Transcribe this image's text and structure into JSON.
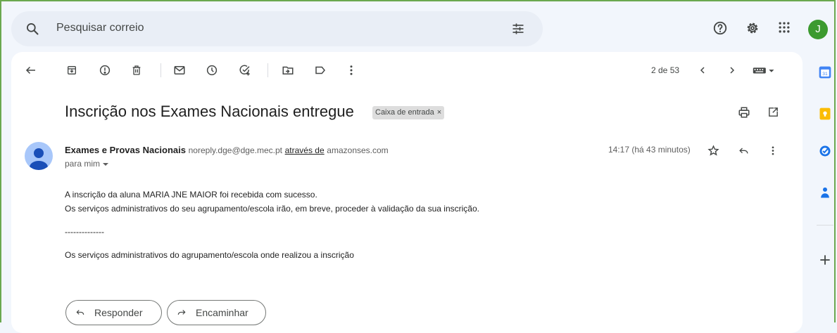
{
  "search": {
    "placeholder": "Pesquisar correio"
  },
  "account": {
    "initial": "J"
  },
  "toolbar": {
    "counter": "2 de 53"
  },
  "email": {
    "subject": "Inscrição nos Exames Nacionais entregue",
    "label_chip": "Caixa de entrada",
    "label_chip_remove": "×",
    "sender_name": "Exames e Provas Nacionais",
    "sender_email": "noreply.dge@dge.mec.pt",
    "via_label": "através de",
    "via_domain": "amazonses.com",
    "to": "para mim",
    "time": "14:17 (há 43 minutos)",
    "body": [
      "A inscrição da aluna MARIA JNE MAIOR foi recebida com sucesso.",
      "Os serviços administrativos do seu agrupamento/escola irão, em breve, proceder à validação da sua inscrição.",
      "--------------",
      "Os serviços administrativos do agrupamento/escola onde realizou a inscrição"
    ]
  },
  "actions": {
    "reply": "Responder",
    "forward": "Encaminhar"
  },
  "side_panel": {
    "calendar_day": "31"
  },
  "colors": {
    "avatar": "#3c9a2f",
    "calendar": "#4285f4",
    "keep": "#fbbc04",
    "tasks": "#1a73e8",
    "contacts": "#1a73e8"
  }
}
